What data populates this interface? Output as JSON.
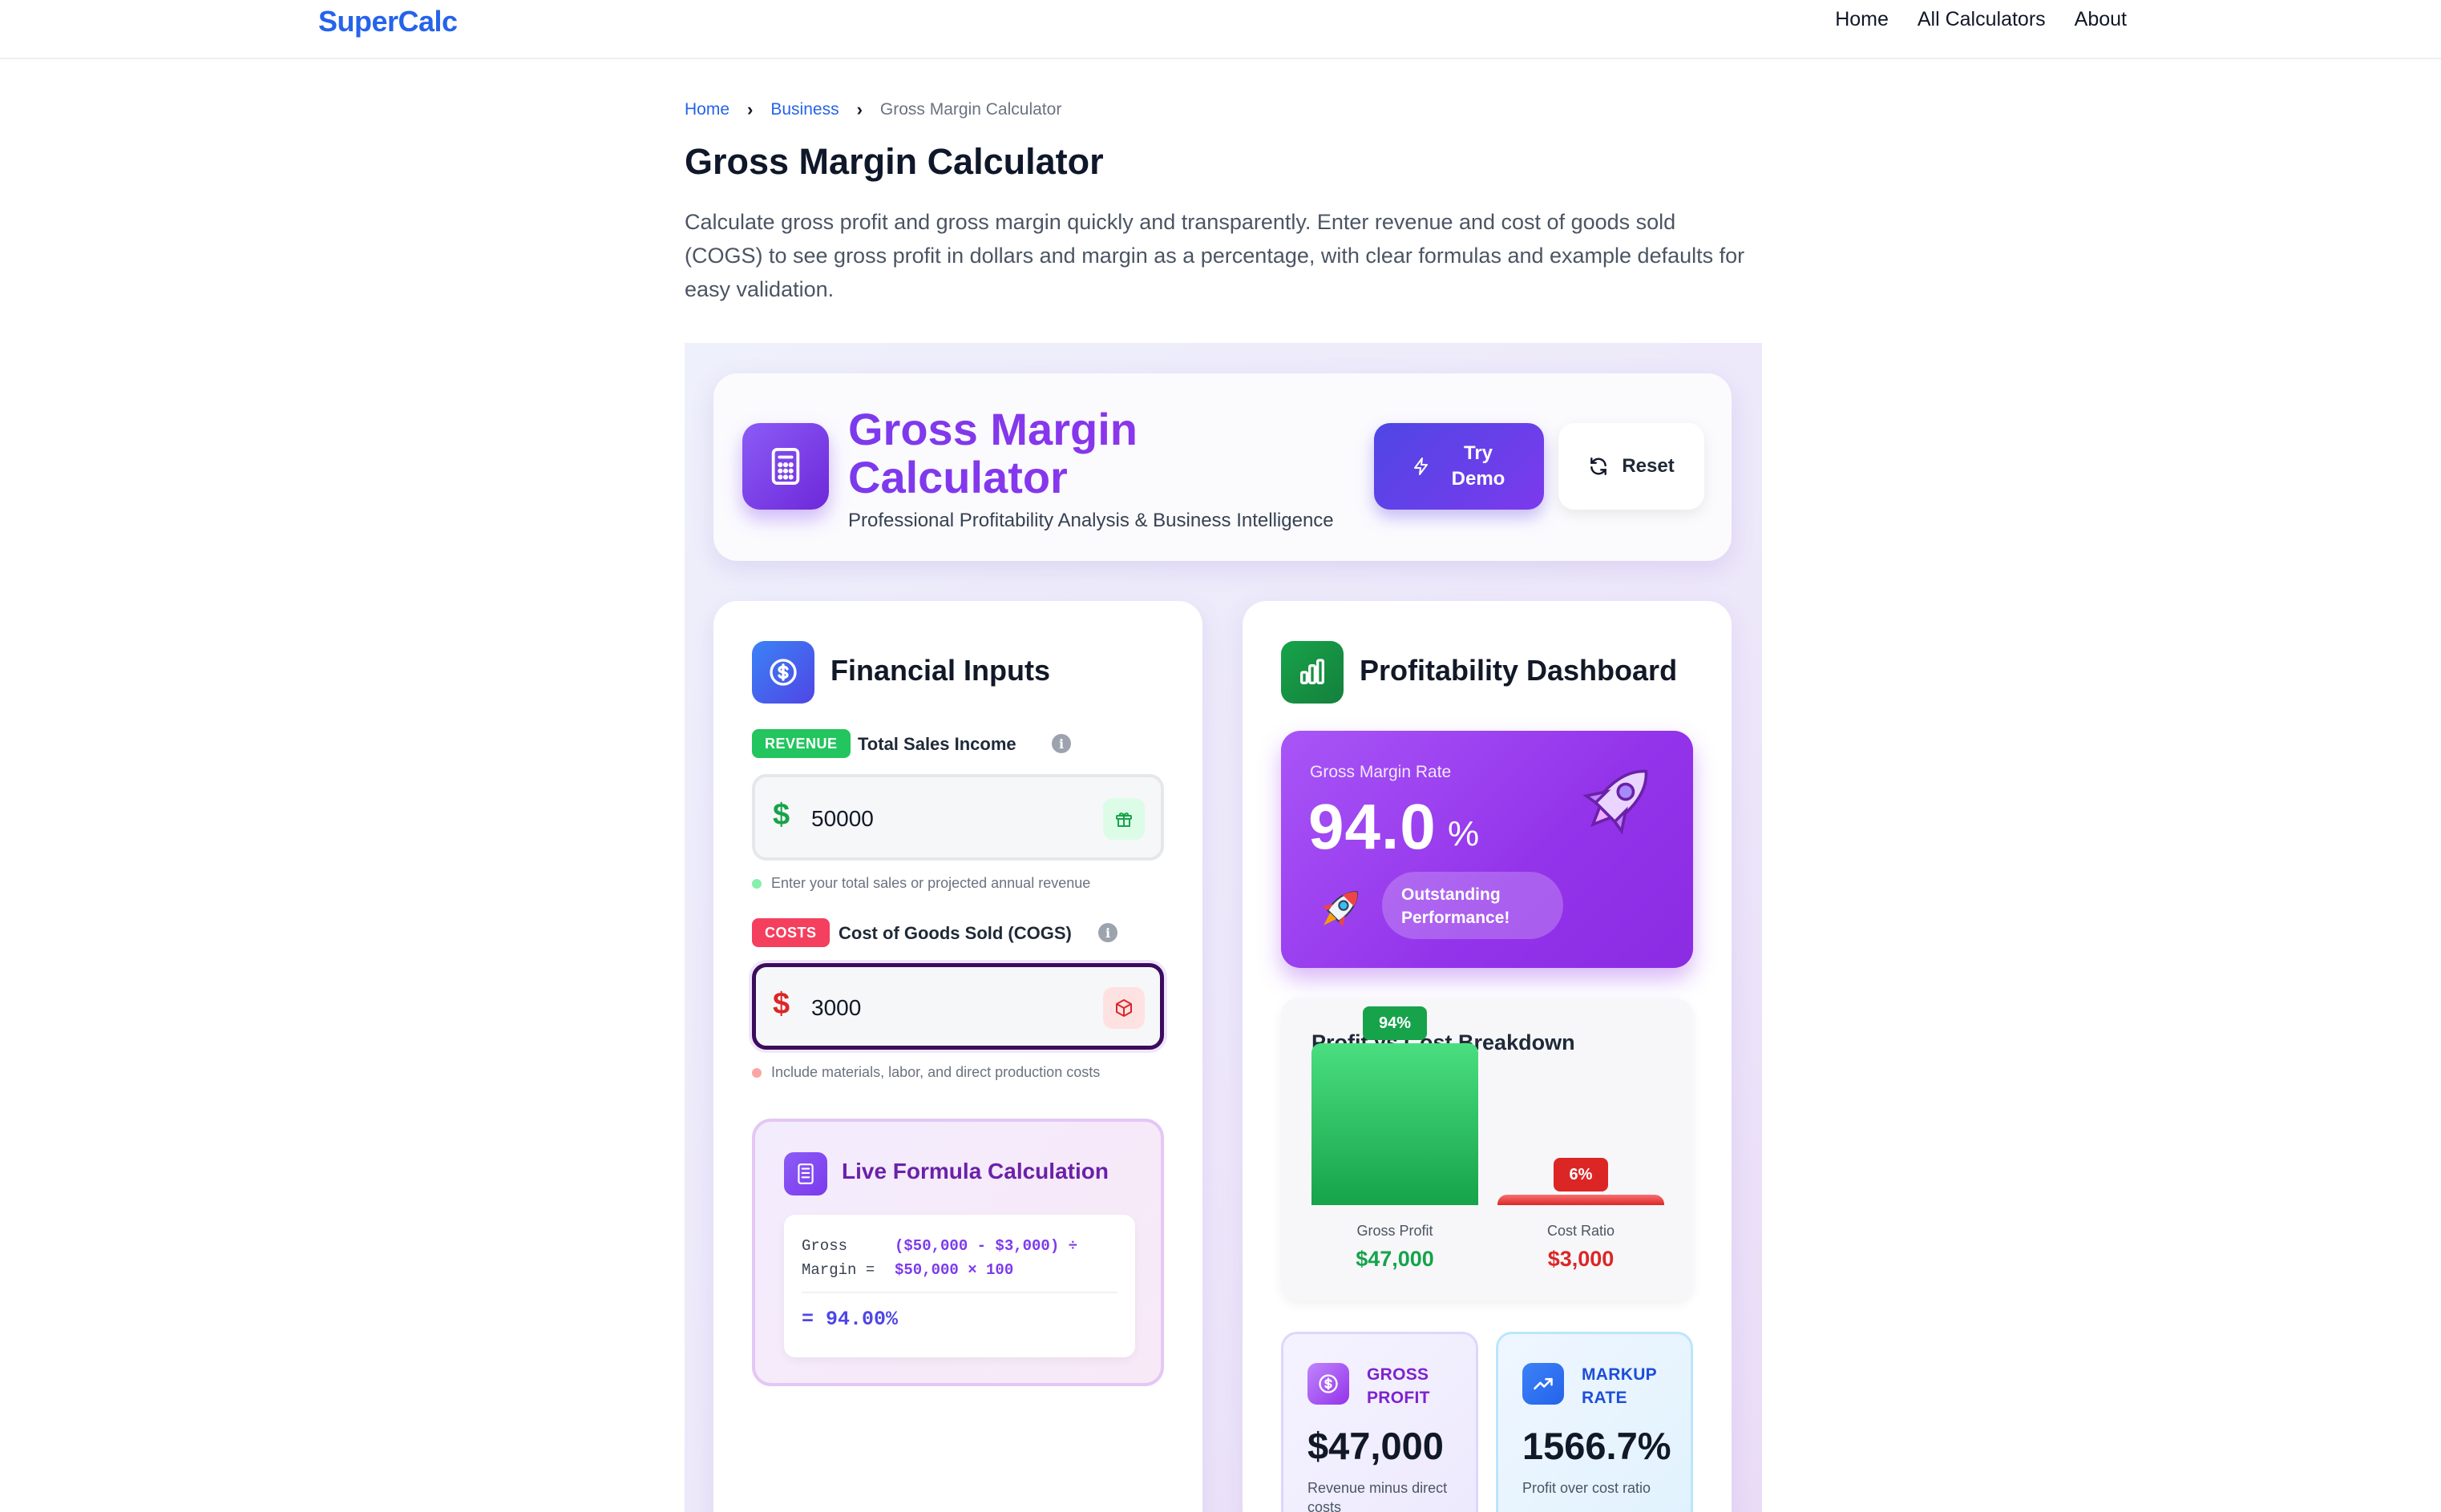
{
  "site": {
    "logo": "SuperCalc",
    "nav": [
      "Home",
      "All Calculators",
      "About"
    ]
  },
  "breadcrumb": {
    "home": "Home",
    "category": "Business",
    "current": "Gross Margin Calculator"
  },
  "page": {
    "title": "Gross Margin Calculator",
    "intro": "Calculate gross profit and gross margin quickly and transparently. Enter revenue and cost of goods sold (COGS) to see gross profit in dollars and margin as a percentage, with clear formulas and example defaults for easy validation."
  },
  "app_header": {
    "title": "Gross Margin Calculator",
    "subtitle": "Professional Profitability Analysis & Business Intelligence",
    "demo_button": "Try Demo",
    "reset_button": "Reset"
  },
  "inputs": {
    "title": "Financial Inputs",
    "revenue": {
      "tag": "REVENUE",
      "label": "Total Sales Income",
      "currency": "$",
      "value": "50000",
      "hint": "Enter your total sales or projected annual revenue"
    },
    "cogs": {
      "tag": "COSTS",
      "label": "Cost of Goods Sold (COGS)",
      "currency": "$",
      "value": "3000",
      "hint": "Include materials, labor, and direct production costs"
    },
    "formula": {
      "title": "Live Formula Calculation",
      "left": "Gross Margin =",
      "right": "($50,000 - $3,000) ÷ $50,000 × 100",
      "result": "= 94.00%"
    }
  },
  "dashboard": {
    "title": "Profitability Dashboard",
    "rate": {
      "label": "Gross Margin Rate",
      "value": "94.0",
      "unit": "%",
      "badge": "Outstanding Performance!"
    },
    "breakdown": {
      "title": "Profit vs Cost Breakdown",
      "profit": {
        "tag": "94%",
        "fraction": 0.94,
        "label": "Gross Profit",
        "amount": "$47,000"
      },
      "cost": {
        "tag": "6%",
        "fraction": 0.06,
        "label": "Cost Ratio",
        "amount": "$3,000"
      }
    },
    "gross_profit": {
      "label": "GROSS PROFIT",
      "value": "$47,000",
      "desc": "Revenue minus direct costs"
    },
    "markup": {
      "label": "MARKUP RATE",
      "value": "1566.7%",
      "desc": "Profit over cost ratio"
    }
  },
  "colors": {
    "brand": "#2563eb",
    "purple": "#7c3aed",
    "green": "#16a34a",
    "red": "#dc2626"
  }
}
